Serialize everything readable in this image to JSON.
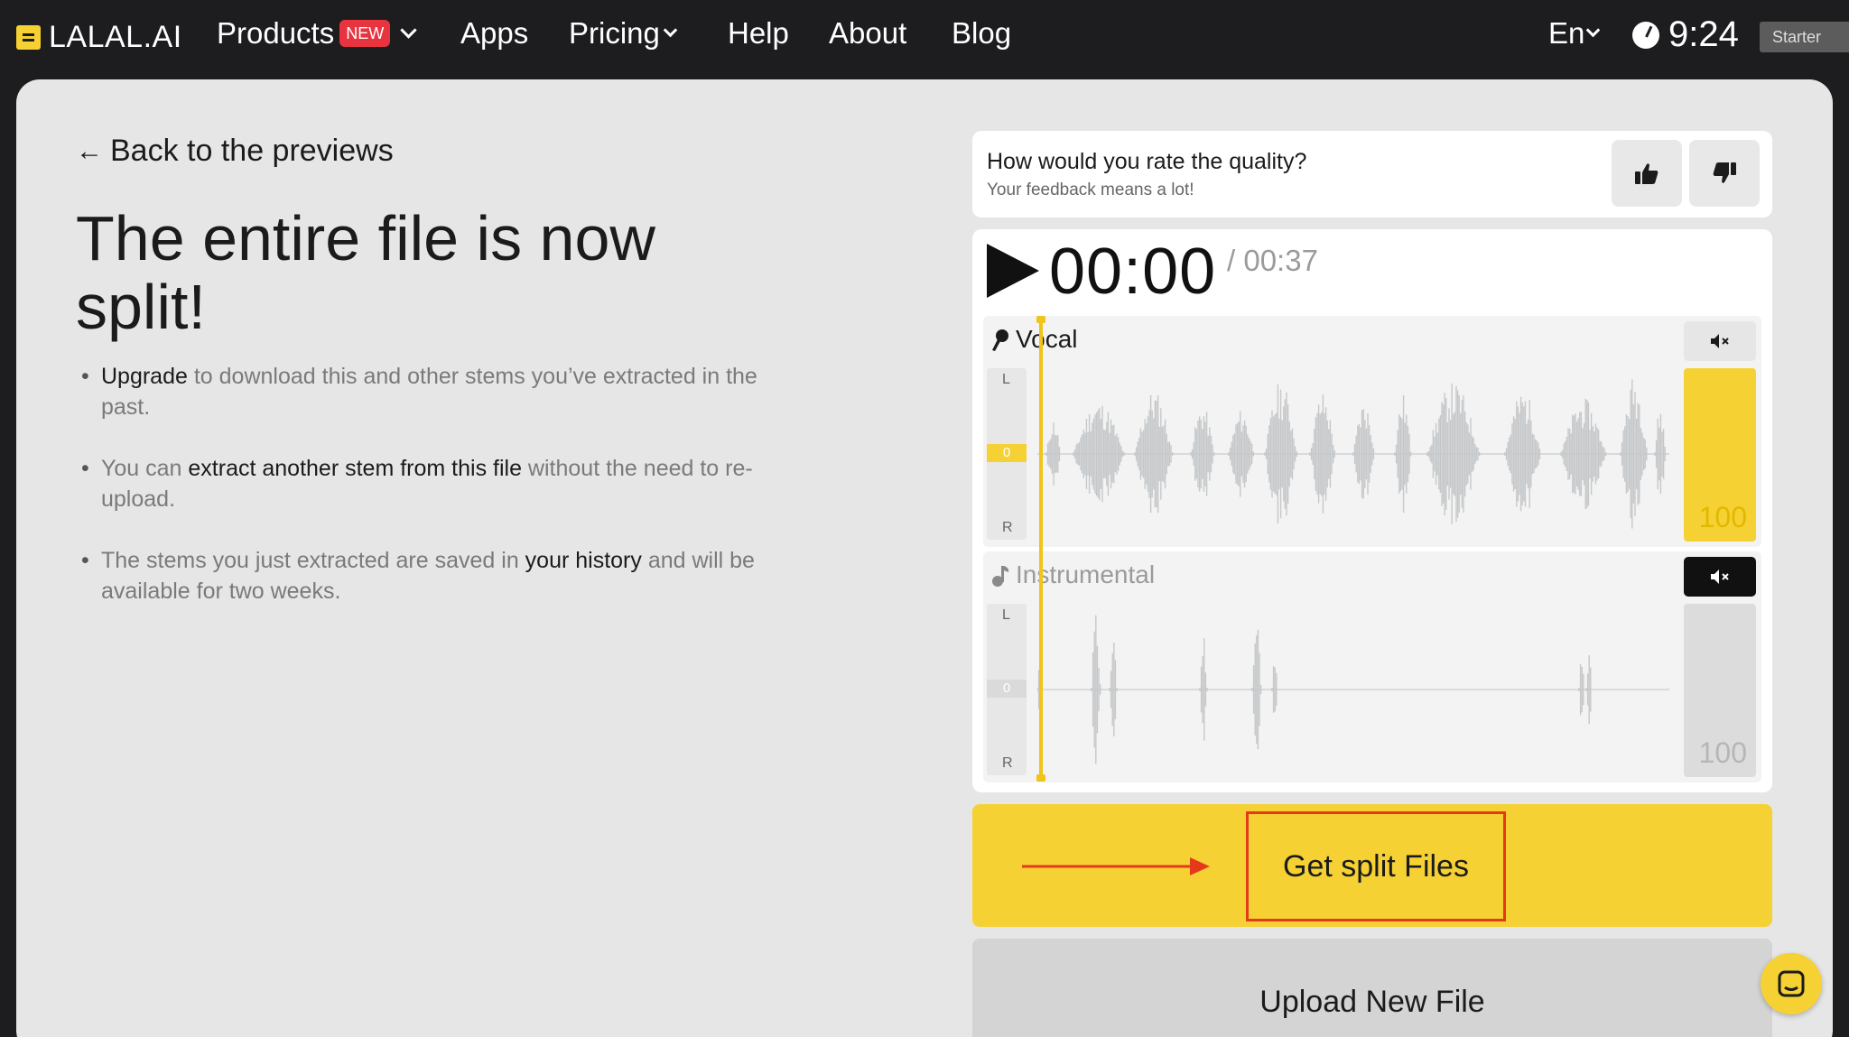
{
  "nav": {
    "logo": "LALAL.AI",
    "products": "Products",
    "new_badge": "NEW",
    "apps": "Apps",
    "pricing": "Pricing",
    "help": "Help",
    "about": "About",
    "blog": "Blog",
    "language": "En",
    "time": "9:24",
    "plan": "Starter"
  },
  "left": {
    "back_link": "Back to the previews",
    "headline": "The entire file is now split!",
    "bullet1": {
      "hl": "Upgrade",
      "text": " to download this and other stems you’ve extracted in the past."
    },
    "bullet2": {
      "pre": "You can ",
      "hl": "extract another stem from this file",
      "post": " without the need to re-upload."
    },
    "bullet3": {
      "pre": "The stems you just extracted are saved in ",
      "hl": "your history",
      "post": " and will be available for two weeks."
    }
  },
  "feedback": {
    "question": "How would you rate the quality?",
    "subtitle": "Your feedback means a lot!",
    "thumbs_up_icon": "thumbs-up-icon",
    "thumbs_down_icon": "thumbs-down-icon"
  },
  "player": {
    "current_time": "00:00",
    "total_time": "/ 00:37",
    "tracks": [
      {
        "name": "Vocal",
        "left_label": "L",
        "right_label": "R",
        "zero_label": "0",
        "volume": "100",
        "muted": false
      },
      {
        "name": "Instrumental",
        "left_label": "L",
        "right_label": "R",
        "zero_label": "0",
        "volume": "100",
        "muted": true
      }
    ],
    "colors": {
      "accent": "#f6d133",
      "wave": "#c5c8ca"
    }
  },
  "actions": {
    "get_split_files": "Get split Files",
    "upload_new_file": "Upload New File"
  }
}
